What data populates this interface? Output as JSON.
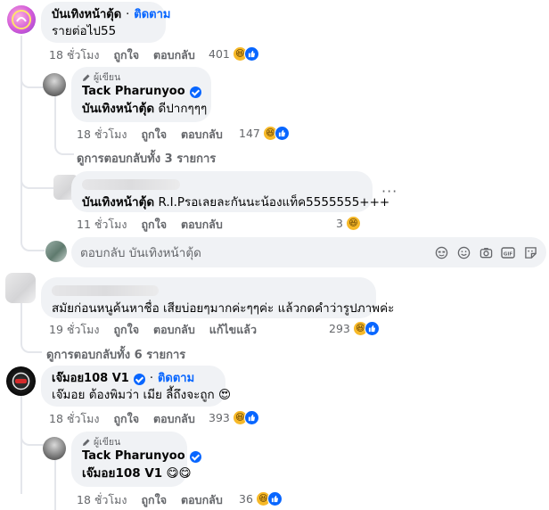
{
  "comments": [
    {
      "name": "บันเทิงหน้าตุ้ด",
      "follow": "ติดตาม",
      "text": "รายต่อไป55",
      "time": "18 ชั่วโมง",
      "like": "ถูกใจ",
      "reply": "ตอบกลับ",
      "reactions": "401",
      "replies": [
        {
          "badge": "ผู้เขียน",
          "name": "Tack Pharunyoo",
          "tag": "บันเทิงหน้าตุ้ด",
          "text": "ดีปากๆๆๆ",
          "time": "18 ชั่วโมง",
          "like": "ถูกใจ",
          "reply": "ตอบกลับ",
          "reactions": "147"
        }
      ],
      "view_replies": "ดูการตอบกลับทั้ง 3 รายการ",
      "reply2": {
        "tag": "บันเทิงหน้าตุ้ด",
        "text": "R.I.Pรอเลยละกันนะน้องแท็ค5555555+++",
        "time": "11 ชั่วโมง",
        "like": "ถูกใจ",
        "reply": "ตอบกลับ",
        "reactions": "3"
      },
      "reply_box_placeholder": "ตอบกลับ บันเทิงหน้าตุ้ด"
    },
    {
      "text": "สมัยก่อนหนูค้นหาชื่อ เสียบ่อยๆมากค่ะๆๆค่ะ แล้วกดคำว่ารูปภาพค่ะ",
      "time": "19 ชั่วโมง",
      "like": "ถูกใจ",
      "reply": "ตอบกลับ",
      "edited": "แก้ไขแล้ว",
      "reactions": "293",
      "view_replies": "ดูการตอบกลับทั้ง 6 รายการ"
    },
    {
      "name": "เจ๊มอย108 V1",
      "follow": "ติดตาม",
      "text": "เจ๊มอย ต้องพิมว่า เมีย ลี้ถึงจะถูก",
      "time": "18 ชั่วโมง",
      "like": "ถูกใจ",
      "reply": "ตอบกลับ",
      "reactions": "393",
      "replies": [
        {
          "badge": "ผู้เขียน",
          "name": "Tack Pharunyoo",
          "tag": "เจ๊มอย108 V1",
          "time": "18 ชั่วโมง",
          "like": "ถูกใจ",
          "reply": "ตอบกลับ",
          "reactions": "36"
        }
      ]
    }
  ],
  "dot": "·",
  "colors": {
    "accent": "#0866ff",
    "bubble": "#f0f2f5",
    "meta": "#65676b",
    "haha": "#f7b928"
  },
  "icons": [
    "pencil-icon",
    "verified-icon",
    "haha-reaction-icon",
    "like-reaction-icon",
    "emoji-icon",
    "camera-icon",
    "gif-icon",
    "sticker-icon",
    "avatar-sticker-icon"
  ]
}
